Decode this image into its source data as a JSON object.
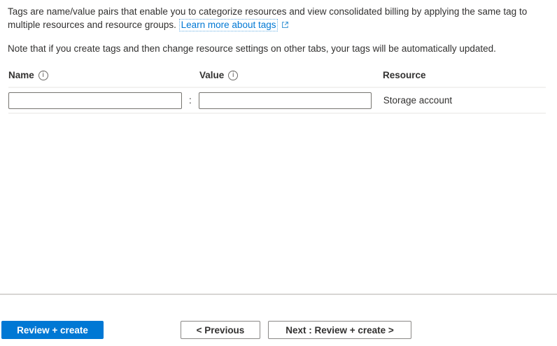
{
  "page": {
    "description": "Tags are name/value pairs that enable you to categorize resources and view consolidated billing by applying the same tag to multiple resources and resource groups.",
    "learn_more_link": "Learn more about tags",
    "note": "Note that if you create tags and then change resource settings on other tabs, your tags will be automatically updated."
  },
  "table": {
    "headers": {
      "name": "Name",
      "value": "Value",
      "resource": "Resource"
    },
    "separator": ":",
    "rows": [
      {
        "name": "",
        "name_placeholder": "",
        "value": "",
        "value_placeholder": "",
        "resource": "Storage account"
      }
    ]
  },
  "icons": {
    "info": "i",
    "external_link": "box-arrow-up-right"
  },
  "buttons": {
    "review_create": "Review + create",
    "previous": "< Previous",
    "next": "Next : Review + create >"
  },
  "colors": {
    "primary_blue": "#0078d4",
    "link_blue": "#0078d4",
    "focus_dotted_blue": "#69b1e4",
    "divider_light": "#f3f2f1",
    "divider_footer": "#d8d6d4"
  }
}
